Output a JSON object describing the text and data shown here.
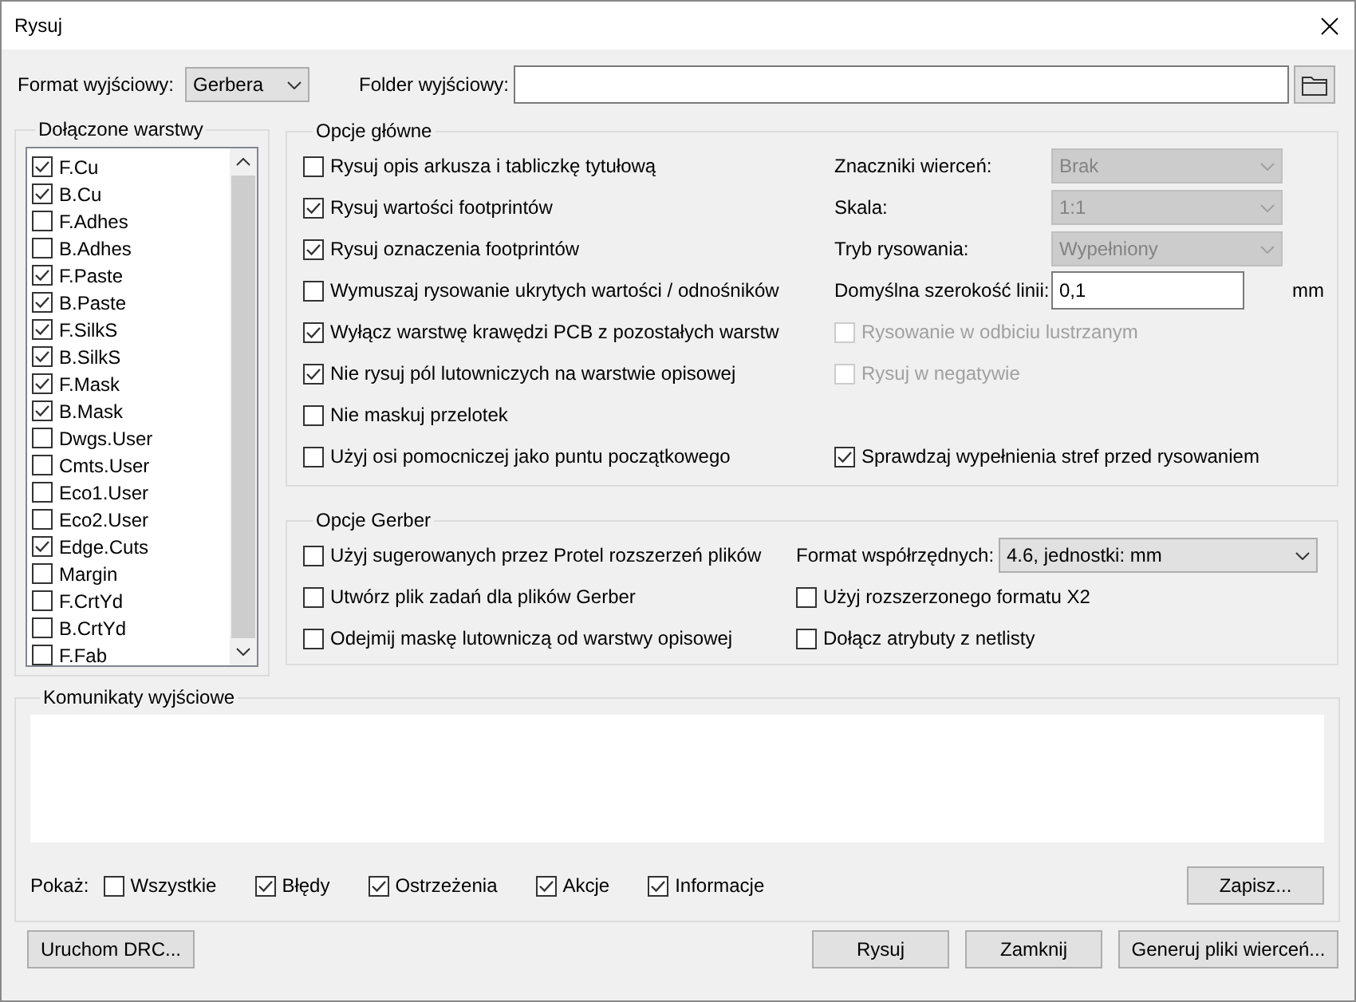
{
  "window": {
    "title": "Rysuj"
  },
  "output_format": {
    "label": "Format wyjściowy:",
    "value": "Gerbera"
  },
  "output_folder": {
    "label": "Folder wyjściowy:"
  },
  "layers": {
    "title": "Dołączone warstwy",
    "items": [
      {
        "label": "F.Cu",
        "checked": true
      },
      {
        "label": "B.Cu",
        "checked": true
      },
      {
        "label": "F.Adhes",
        "checked": false
      },
      {
        "label": "B.Adhes",
        "checked": false
      },
      {
        "label": "F.Paste",
        "checked": true
      },
      {
        "label": "B.Paste",
        "checked": true
      },
      {
        "label": "F.SilkS",
        "checked": true
      },
      {
        "label": "B.SilkS",
        "checked": true
      },
      {
        "label": "F.Mask",
        "checked": true
      },
      {
        "label": "B.Mask",
        "checked": true
      },
      {
        "label": "Dwgs.User",
        "checked": false
      },
      {
        "label": "Cmts.User",
        "checked": false
      },
      {
        "label": "Eco1.User",
        "checked": false
      },
      {
        "label": "Eco2.User",
        "checked": false
      },
      {
        "label": "Edge.Cuts",
        "checked": true
      },
      {
        "label": "Margin",
        "checked": false
      },
      {
        "label": "F.CrtYd",
        "checked": false
      },
      {
        "label": "B.CrtYd",
        "checked": false
      },
      {
        "label": "F.Fab",
        "checked": false
      }
    ]
  },
  "main_options": {
    "title": "Opcje główne",
    "checkboxes": [
      {
        "label": "Rysuj opis arkusza i tabliczkę tytułową",
        "checked": false
      },
      {
        "label": "Rysuj wartości footprintów",
        "checked": true
      },
      {
        "label": "Rysuj oznaczenia footprintów",
        "checked": true
      },
      {
        "label": "Wymuszaj rysowanie ukrytych wartości / odnośników",
        "checked": false
      },
      {
        "label": "Wyłącz warstwę krawędzi PCB z pozostałych warstw",
        "checked": true
      },
      {
        "label": "Nie rysuj pól lutowniczych na warstwie opisowej",
        "checked": true
      },
      {
        "label": "Nie maskuj przelotek",
        "checked": false
      },
      {
        "label": "Użyj osi pomocniczej jako puntu początkowego",
        "checked": false
      }
    ],
    "settings": [
      {
        "kind": "select",
        "label": "Znaczniki wierceń:",
        "value": "Brak",
        "disabled": true
      },
      {
        "kind": "select",
        "label": "Skala:",
        "value": "1:1",
        "disabled": true
      },
      {
        "kind": "select",
        "label": "Tryb rysowania:",
        "value": "Wypełniony",
        "disabled": true
      },
      {
        "kind": "input",
        "label": "Domyślna szerokość linii:",
        "value": "0,1",
        "unit": "mm"
      },
      {
        "kind": "checkbox",
        "label": "Rysowanie w odbiciu lustrzanym",
        "checked": false,
        "disabled": true
      },
      {
        "kind": "checkbox",
        "label": "Rysuj w negatywie",
        "checked": false,
        "disabled": true
      },
      {
        "kind": "checkbox",
        "label": "Sprawdzaj wypełnienia stref przed rysowaniem",
        "checked": true,
        "disabled": false
      }
    ]
  },
  "gerber_options": {
    "title": "Opcje Gerber",
    "checkboxes": [
      {
        "label": "Użyj sugerowanych przez Protel rozszerzeń plików",
        "checked": false
      },
      {
        "label": "Utwórz plik zadań dla plików Gerber",
        "checked": false
      },
      {
        "label": "Odejmij maskę lutowniczą od warstwy opisowej",
        "checked": false
      }
    ],
    "coordinate_format": {
      "label": "Format współrzędnych:",
      "value": "4.6, jednostki: mm"
    },
    "extra_checkboxes": [
      {
        "label": "Użyj rozszerzonego formatu X2",
        "checked": false
      },
      {
        "label": "Dołącz atrybuty z netlisty",
        "checked": false
      }
    ]
  },
  "messages": {
    "title": "Komunikaty wyjściowe",
    "show_label": "Pokaż:",
    "filters": [
      {
        "label": "Wszystkie",
        "checked": false
      },
      {
        "label": "Błędy",
        "checked": true
      },
      {
        "label": "Ostrzeżenia",
        "checked": true
      },
      {
        "label": "Akcje",
        "checked": true
      },
      {
        "label": "Informacje",
        "checked": true
      }
    ],
    "save_button": "Zapisz..."
  },
  "buttons": {
    "left": "Uruchom DRC...",
    "right": [
      "Rysuj",
      "Zamknij",
      "Generuj pliki wierceń..."
    ]
  }
}
